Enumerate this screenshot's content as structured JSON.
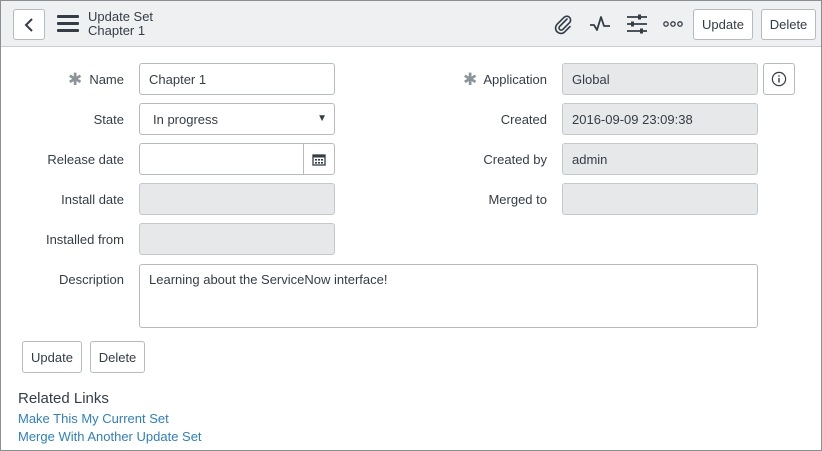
{
  "header": {
    "title": "Update Set",
    "subtitle": "Chapter 1",
    "icons": [
      "back-icon",
      "menu-icon",
      "paperclip-icon",
      "activity-icon",
      "sliders-icon",
      "more-icon"
    ],
    "update_label": "Update",
    "delete_label": "Delete"
  },
  "form": {
    "name": {
      "label": "Name",
      "value": "Chapter 1",
      "required": true
    },
    "state": {
      "label": "State",
      "value": "In progress"
    },
    "release_date": {
      "label": "Release date",
      "value": ""
    },
    "install_date": {
      "label": "Install date",
      "value": ""
    },
    "installed_from": {
      "label": "Installed from",
      "value": ""
    },
    "application": {
      "label": "Application",
      "value": "Global",
      "required": true
    },
    "created": {
      "label": "Created",
      "value": "2016-09-09 23:09:38"
    },
    "created_by": {
      "label": "Created by",
      "value": "admin"
    },
    "merged_to": {
      "label": "Merged to",
      "value": ""
    },
    "description": {
      "label": "Description",
      "value": "Learning about the ServiceNow interface!"
    }
  },
  "actions": {
    "update_label": "Update",
    "delete_label": "Delete"
  },
  "related_links": {
    "title": "Related Links",
    "links": [
      "Make This My Current Set",
      "Merge With Another Update Set"
    ]
  },
  "colors": {
    "header_bg": "#eef0f1",
    "readonly_bg": "#e6e8ea",
    "link": "#2e7fc4",
    "text": "#343d47"
  }
}
